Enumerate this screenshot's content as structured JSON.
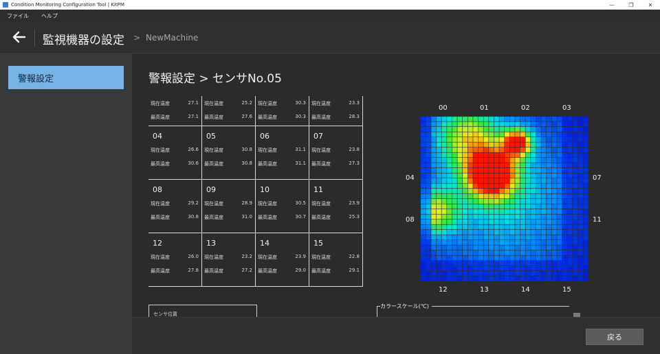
{
  "window": {
    "title": "Condition Monitoring Configuration Tool | KitPM",
    "controls": [
      "—",
      "❐",
      "✕"
    ]
  },
  "menu": {
    "items": [
      "ファイル",
      "ヘルプ"
    ]
  },
  "header": {
    "back_icon": "arrow-left-icon",
    "title": "監視機器の設定",
    "crumb_sep": ">",
    "crumb": "NewMachine"
  },
  "sidebar": {
    "items": [
      {
        "label": "警報設定"
      }
    ]
  },
  "page": {
    "title": "警報設定 > センサNo.05"
  },
  "sensor_grid": [
    {
      "id": "00",
      "show_id": false,
      "current_label": "現在温度",
      "current": "27.1",
      "max_label": "最高温度",
      "max": "27.1"
    },
    {
      "id": "01",
      "show_id": false,
      "current_label": "現在温度",
      "current": "25.2",
      "max_label": "最高温度",
      "max": "27.6"
    },
    {
      "id": "02",
      "show_id": false,
      "current_label": "現在温度",
      "current": "30.3",
      "max_label": "最高温度",
      "max": "30.3"
    },
    {
      "id": "03",
      "show_id": false,
      "current_label": "現在温度",
      "current": "23.3",
      "max_label": "最高温度",
      "max": "28.3"
    },
    {
      "id": "04",
      "show_id": true,
      "current_label": "現在温度",
      "current": "26.6",
      "max_label": "最高温度",
      "max": "30.6"
    },
    {
      "id": "05",
      "show_id": true,
      "current_label": "現在温度",
      "current": "30.8",
      "max_label": "最高温度",
      "max": "30.8"
    },
    {
      "id": "06",
      "show_id": true,
      "current_label": "現在温度",
      "current": "31.1",
      "max_label": "最高温度",
      "max": "31.1"
    },
    {
      "id": "07",
      "show_id": true,
      "current_label": "現在温度",
      "current": "23.8",
      "max_label": "最高温度",
      "max": "27.3"
    },
    {
      "id": "08",
      "show_id": true,
      "current_label": "現在温度",
      "current": "29.2",
      "max_label": "最高温度",
      "max": "30.8"
    },
    {
      "id": "09",
      "show_id": true,
      "current_label": "現在温度",
      "current": "28.9",
      "max_label": "最高温度",
      "max": "31.0"
    },
    {
      "id": "10",
      "show_id": true,
      "current_label": "現在温度",
      "current": "30.5",
      "max_label": "最高温度",
      "max": "30.7"
    },
    {
      "id": "11",
      "show_id": true,
      "current_label": "現在温度",
      "current": "23.9",
      "max_label": "最高温度",
      "max": "25.3"
    },
    {
      "id": "12",
      "show_id": true,
      "current_label": "現在温度",
      "current": "26.0",
      "max_label": "最高温度",
      "max": "27.8"
    },
    {
      "id": "13",
      "show_id": true,
      "current_label": "現在温度",
      "current": "23.2",
      "max_label": "最高温度",
      "max": "27.2"
    },
    {
      "id": "14",
      "show_id": true,
      "current_label": "現在温度",
      "current": "23.9",
      "max_label": "最高温度",
      "max": "29.0"
    },
    {
      "id": "15",
      "show_id": true,
      "current_label": "現在温度",
      "current": "22.8",
      "max_label": "最高温度",
      "max": "29.1"
    }
  ],
  "heatmap": {
    "top_labels": [
      "00",
      "01",
      "02",
      "03"
    ],
    "left_labels": [
      "04",
      "08"
    ],
    "right_labels": [
      "07",
      "11"
    ],
    "bottom_labels": [
      "12",
      "13",
      "14",
      "15"
    ]
  },
  "sensor_position": {
    "label": "センサ位置"
  },
  "color_scale": {
    "label": "カラースケール(℃)"
  },
  "footer": {
    "back_label": "戻る"
  },
  "colors": {
    "accent": "#76b3e6",
    "heat_low": "#0000d8",
    "heat_high": "#ff0000"
  }
}
